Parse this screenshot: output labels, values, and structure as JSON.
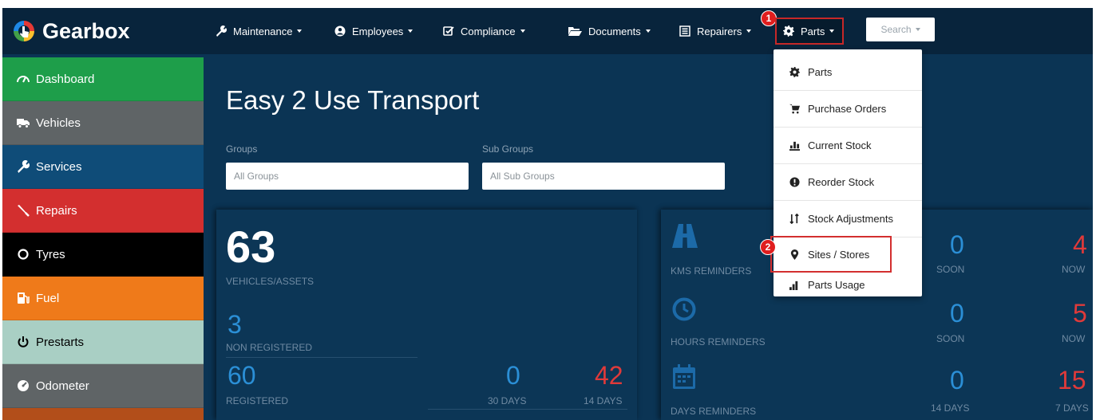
{
  "brand": {
    "name": "Gearbox"
  },
  "nav": {
    "maintenance": "Maintenance",
    "employees": "Employees",
    "compliance": "Compliance",
    "documents": "Documents",
    "repairers": "Repairers",
    "parts": "Parts",
    "search": "Search"
  },
  "annotations": {
    "step1": "1",
    "step2": "2"
  },
  "sidebar": {
    "items": [
      {
        "label": "Dashboard",
        "color": "#1e9e4a",
        "icon": "speedometer-icon"
      },
      {
        "label": "Vehicles",
        "color": "#5f6466",
        "icon": "truck-icon"
      },
      {
        "label": "Services",
        "color": "#0f4c78",
        "icon": "wrench-icon"
      },
      {
        "label": "Repairs",
        "color": "#d32f2f",
        "icon": "screwdriver-icon"
      },
      {
        "label": "Tyres",
        "color": "#000000",
        "icon": "tyre-icon"
      },
      {
        "label": "Fuel",
        "color": "#ef7a1a",
        "icon": "fuel-pump-icon"
      },
      {
        "label": "Prestarts",
        "color": "#a9cfc4",
        "icon": "power-icon"
      },
      {
        "label": "Odometer",
        "color": "#5f6466",
        "icon": "dashboard-gauge-icon"
      }
    ]
  },
  "main": {
    "title": "Easy 2 Use Transport",
    "groups_label": "Groups",
    "groups_value": "All Groups",
    "subgroups_label": "Sub Groups",
    "subgroups_value": "All Sub Groups"
  },
  "vehicles_panel": {
    "total": "63",
    "total_label": "VEHICLES/ASSETS",
    "non_registered": "3",
    "non_registered_label": "NON REGISTERED",
    "registered": "60",
    "registered_label": "REGISTERED",
    "days30": "0",
    "days30_label": "30 DAYS",
    "days14": "42",
    "days14_label": "14 DAYS"
  },
  "reminders_panel": {
    "kms_label": "KMS REMINDERS",
    "kms_soon": "0",
    "kms_now": "4",
    "hours_label": "HOURS REMINDERS",
    "hours_soon": "0",
    "hours_now": "5",
    "days_label": "DAYS REMINDERS",
    "days_14": "0",
    "days_7": "15",
    "soon_label": "SOON",
    "now_label": "NOW",
    "days14_label": "14 DAYS",
    "days7_label": "7 DAYS"
  },
  "parts_menu": {
    "items": [
      {
        "label": "Parts",
        "icon": "gear-icon"
      },
      {
        "label": "Purchase Orders",
        "icon": "cart-icon"
      },
      {
        "label": "Current Stock",
        "icon": "stock-bars-icon"
      },
      {
        "label": "Reorder Stock",
        "icon": "exclamation-circle-icon"
      },
      {
        "label": "Stock Adjustments",
        "icon": "sort-arrows-icon"
      },
      {
        "label": "Sites / Stores",
        "icon": "map-pin-icon"
      },
      {
        "label": "Parts Usage",
        "icon": "bar-chart-icon"
      }
    ]
  }
}
